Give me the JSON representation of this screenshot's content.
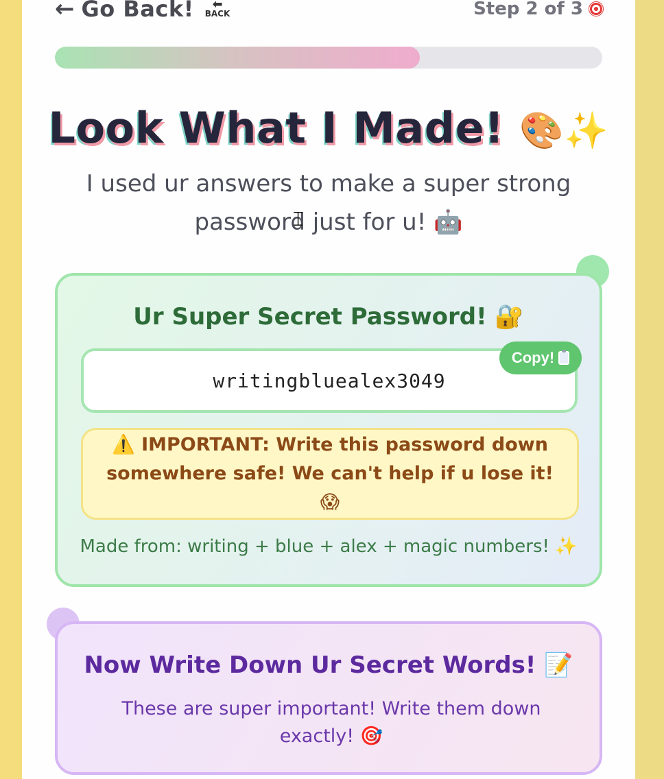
{
  "nav": {
    "back_arrow": "←",
    "back_label": "Go Back!",
    "back_emoji_text": "BACK",
    "step_text": "Step 2 of 3"
  },
  "progress": {
    "fraction": 0.667
  },
  "hero": {
    "title": "Look What I Made!",
    "title_emoji": "🎨✨",
    "subtitle": "I used ur answers to make a super strong password just for u! 🤖"
  },
  "password_card": {
    "title": "Ur Super Secret Password! 🔐",
    "password": "writingbluealex3049",
    "copy_label": "Copy!",
    "warning_icon": "⚠️",
    "warning_text": "IMPORTANT: Write this password down somewhere safe! We can't help if u lose it! 😱",
    "made_from": "Made from: writing + blue + alex + magic numbers! ✨"
  },
  "words_card": {
    "title": "Now Write Down Ur Secret Words! 📝",
    "subtitle": "These are super important! Write them down exactly! 🎯"
  },
  "colors": {
    "background": "#f5dc7d",
    "green_accent": "#5fc56e",
    "purple_accent": "#5c2a9e",
    "warning_text": "#8b4a17"
  }
}
